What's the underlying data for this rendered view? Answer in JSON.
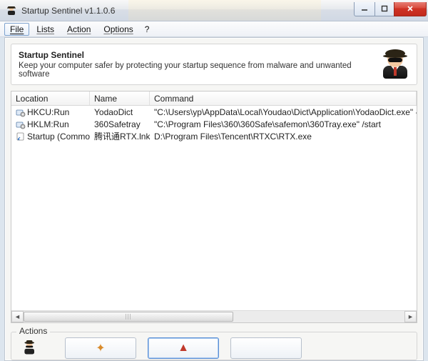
{
  "window": {
    "title": "Startup Sentinel v1.1.0.6"
  },
  "menu": {
    "file": "File",
    "lists": "Lists",
    "action": "Action",
    "options": "Options",
    "help": "?"
  },
  "header": {
    "title": "Startup Sentinel",
    "subtitle": "Keep your computer safer by protecting your startup sequence from malware and unwanted software"
  },
  "table": {
    "headers": {
      "location": "Location",
      "name": "Name",
      "command": "Command"
    },
    "rows": [
      {
        "icon": "gear",
        "location": "HKCU:Run",
        "name": "YodaoDict",
        "command": "\"C:\\Users\\yp\\AppData\\Local\\Youdao\\Dict\\Application\\YodaoDict.exe\" -hide"
      },
      {
        "icon": "gear",
        "location": "HKLM:Run",
        "name": "360Safetray",
        "command": "\"C:\\Program Files\\360\\360Safe\\safemon\\360Tray.exe\" /start"
      },
      {
        "icon": "link",
        "location": "Startup (Common)",
        "name": "腾讯通RTX.lnk",
        "command": "D:\\Program Files\\Tencent\\RTXC\\RTX.exe"
      }
    ]
  },
  "actions": {
    "label": "Actions"
  }
}
